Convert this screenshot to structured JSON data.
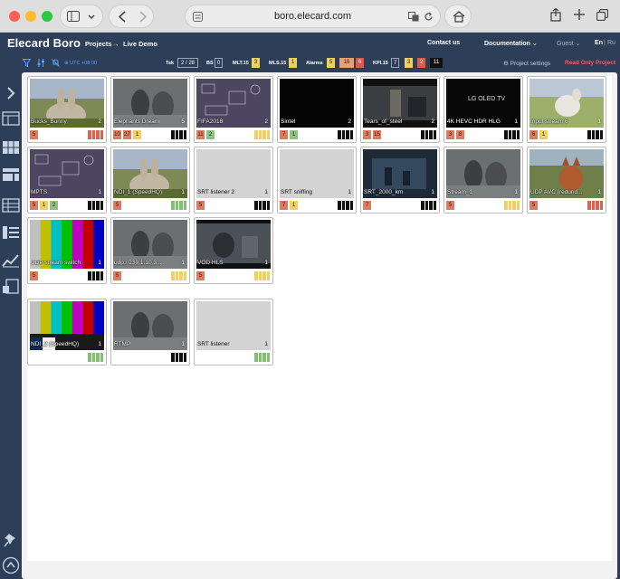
{
  "browser": {
    "url": "boro.elecard.com"
  },
  "header": {
    "logo": "Elecard Boro",
    "breadcrumb_projects": "Projects",
    "breadcrumb_arrow": "→",
    "breadcrumb_current": "Live Demo",
    "contact": "Contact us",
    "documentation": "Documentation",
    "guest": "Guest",
    "lang_en": "En",
    "lang_sep": "|",
    "lang_ru": "Ru"
  },
  "toolbar": {
    "timezone": "UTC +08:00",
    "tsk_label": "Tsk",
    "tsk_value": "2 / 28",
    "bs_label": "BS",
    "bs_value": "0",
    "mlt_label": "MLT.15",
    "mlt_value": "3",
    "mls_label": "MLS.15",
    "mls_value": "1",
    "alarms_label": "Alarms",
    "alarms_values": [
      "5",
      "16",
      "6"
    ],
    "kpi_label": "KPI.15",
    "kpi_values": [
      "7",
      "3",
      "2",
      "11"
    ],
    "project_settings": "Project settings",
    "read_only": "Read Only Project"
  },
  "colors": {
    "badge_red": "#e07a5f",
    "badge_yellow": "#f0d060",
    "badge_green": "#8cc084",
    "bar_red": "#e06050",
    "bar_yellow": "#f0d060",
    "bar_green": "#80c070",
    "bar_black": "#111111"
  },
  "tiles": [
    {
      "name": "Bucks_Bunny",
      "count": "2",
      "scene": "bunny",
      "badges": [
        {
          "v": "5",
          "c": "red"
        }
      ],
      "bars": "red"
    },
    {
      "name": "Elephants Dream",
      "count": "5",
      "scene": "gray",
      "badges": [
        {
          "v": "10",
          "c": "red"
        },
        {
          "v": "27",
          "c": "red"
        },
        {
          "v": "1",
          "c": "yellow"
        }
      ],
      "bars": "black"
    },
    {
      "name": "FIFA2018",
      "count": "2",
      "scene": "purple",
      "badges": [
        {
          "v": "11",
          "c": "red"
        },
        {
          "v": "2",
          "c": "green"
        }
      ],
      "bars": "yellow"
    },
    {
      "name": "Sintel",
      "count": "2",
      "scene": "black",
      "badges": [
        {
          "v": "7",
          "c": "red"
        },
        {
          "v": "1",
          "c": "green"
        }
      ],
      "bars": "black"
    },
    {
      "name": "Tears_of_steel",
      "count": "2",
      "scene": "tears",
      "badges": [
        {
          "v": "3",
          "c": "red"
        },
        {
          "v": "15",
          "c": "red"
        }
      ],
      "bars": "black"
    },
    {
      "name": "4K HEVC HDR HLG",
      "count": "1",
      "scene": "lg",
      "badges": [
        {
          "v": "3",
          "c": "red"
        },
        {
          "v": "8",
          "c": "red"
        }
      ],
      "bars": "black"
    },
    {
      "name": "Input stream 6",
      "count": "1",
      "scene": "goat",
      "badges": [
        {
          "v": "6",
          "c": "red"
        },
        {
          "v": "1",
          "c": "yellow"
        }
      ],
      "bars": "black"
    },
    {
      "name": "MPTS",
      "count": "1",
      "scene": "purple",
      "badges": [
        {
          "v": "5",
          "c": "red"
        },
        {
          "v": "1",
          "c": "yellow"
        },
        {
          "v": "2",
          "c": "green"
        }
      ],
      "bars": "black"
    },
    {
      "name": "NDI_1 (SpeedHQ)",
      "count": "1",
      "scene": "bunny",
      "badges": [
        {
          "v": "5",
          "c": "red"
        }
      ],
      "bars": "green"
    },
    {
      "name": "SRT listener 2",
      "count": "1",
      "scene": "blank",
      "badges": [
        {
          "v": "5",
          "c": "red"
        }
      ],
      "bars": "black"
    },
    {
      "name": "SRT sniffing",
      "count": "1",
      "scene": "blank",
      "badges": [
        {
          "v": "7",
          "c": "red"
        },
        {
          "v": "1",
          "c": "yellow"
        }
      ],
      "bars": "black"
    },
    {
      "name": "SRT_2000_km",
      "count": "1",
      "scene": "navy",
      "badges": [
        {
          "v": "7",
          "c": "red"
        }
      ],
      "bars": "black"
    },
    {
      "name": "Stream_1",
      "count": "1",
      "scene": "gray",
      "badges": [
        {
          "v": "5",
          "c": "red"
        }
      ],
      "bars": "yellow"
    },
    {
      "name": "UDP AVC (redund...",
      "count": "1",
      "scene": "fox",
      "badges": [
        {
          "v": "5",
          "c": "red"
        }
      ],
      "bars": "red"
    },
    {
      "name": "UDP stream switch",
      "count": "1",
      "scene": "colorbars",
      "badges": [
        {
          "v": "5",
          "c": "red"
        }
      ],
      "bars": "black"
    },
    {
      "name": "udp://239.1.10.3...",
      "count": "1",
      "scene": "gray",
      "badges": [
        {
          "v": "5",
          "c": "red"
        }
      ],
      "bars": "yellow"
    },
    {
      "name": "VOD HLS",
      "count": "1",
      "scene": "hls",
      "badges": [
        {
          "v": "5",
          "c": "red"
        }
      ],
      "bars": "yellow"
    },
    {
      "name": "NDI_2 (SpeedHQ)",
      "count": "1",
      "scene": "smpte",
      "badges": [],
      "bars": "green"
    },
    {
      "name": "RTMP",
      "count": "1",
      "scene": "gray",
      "badges": [],
      "bars": "black"
    },
    {
      "name": "SRT listener",
      "count": "1",
      "scene": "blank",
      "badges": [],
      "bars": "green"
    }
  ]
}
